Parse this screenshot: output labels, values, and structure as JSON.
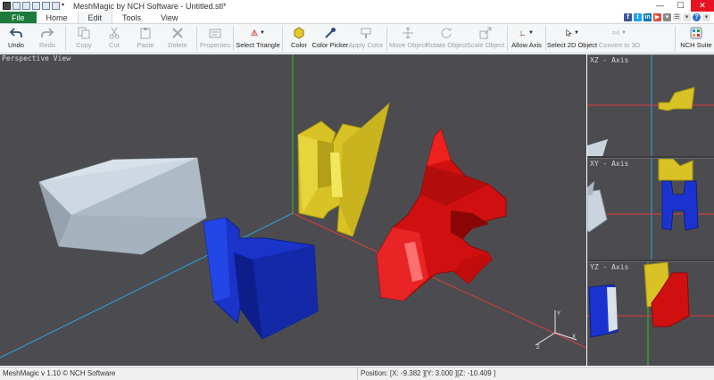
{
  "window": {
    "title": "MeshMagic by NCH Software - Untitled.stl*"
  },
  "menu": {
    "tabs": [
      {
        "label": "File"
      },
      {
        "label": "Home"
      },
      {
        "label": "Edit"
      },
      {
        "label": "Tools"
      },
      {
        "label": "View"
      }
    ],
    "active_tab": "Edit"
  },
  "toolbar": {
    "buttons": [
      {
        "label": "Undo",
        "icon": "undo-icon",
        "enabled": true
      },
      {
        "label": "Redo",
        "icon": "redo-icon",
        "enabled": false
      },
      {
        "label": "Copy",
        "icon": "copy-icon",
        "enabled": false
      },
      {
        "label": "Cut",
        "icon": "cut-icon",
        "enabled": false
      },
      {
        "label": "Paste",
        "icon": "paste-icon",
        "enabled": false
      },
      {
        "label": "Delete",
        "icon": "delete-icon",
        "enabled": false
      },
      {
        "label": "Properties",
        "icon": "properties-icon",
        "enabled": false
      },
      {
        "label": "Select Triangle",
        "icon": "select-triangle-icon",
        "enabled": true
      },
      {
        "label": "Color",
        "icon": "color-icon",
        "enabled": true
      },
      {
        "label": "Color Picker",
        "icon": "color-picker-icon",
        "enabled": true
      },
      {
        "label": "Apply Color",
        "icon": "apply-color-icon",
        "enabled": false
      },
      {
        "label": "Move Object",
        "icon": "move-object-icon",
        "enabled": false
      },
      {
        "label": "Rotate Object",
        "icon": "rotate-object-icon",
        "enabled": false
      },
      {
        "label": "Scale Object",
        "icon": "scale-object-icon",
        "enabled": false
      },
      {
        "label": "Allow Axis",
        "icon": "allow-axis-icon",
        "enabled": true
      },
      {
        "label": "Select 2D Object",
        "icon": "select-2d-object-icon",
        "enabled": true
      },
      {
        "label": "Convert to 3D",
        "icon": "convert-3d-icon",
        "enabled": false
      },
      {
        "label": "NCH Suite",
        "icon": "nch-suite-icon",
        "enabled": true
      }
    ]
  },
  "viewports": {
    "main_label": "Perspective View",
    "xz_label": "XZ - Axis",
    "xy_label": "XY - Axis",
    "yz_label": "YZ - Axis"
  },
  "status": {
    "version": "MeshMagic v 1.10 © NCH Software",
    "position": "Position: [X: -9.382 ][Y: 3.000 ][Z: -10.409 ]"
  },
  "colors": {
    "viewport_bg": "#4c4c50",
    "file_tab": "#1c7a3c",
    "close_button": "#e81123",
    "axis_x": "#e03c3c",
    "axis_y": "#28c428",
    "axis_z": "#2aa6e6"
  }
}
